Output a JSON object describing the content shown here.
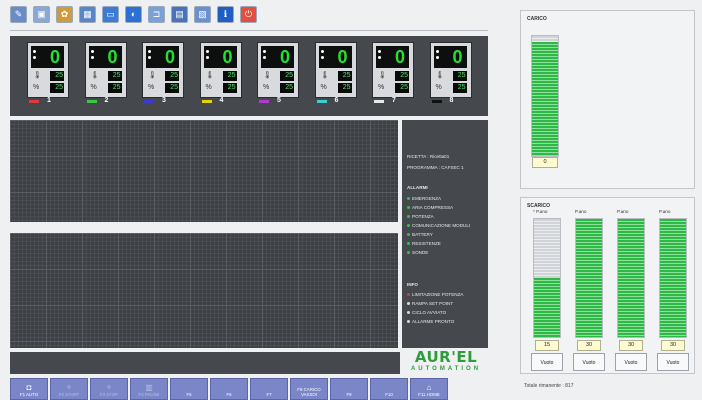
{
  "toolbar": {
    "icons": [
      {
        "name": "edit-icon",
        "color": "#6a8bc8"
      },
      {
        "name": "image-icon",
        "color": "#8aa7d6"
      },
      {
        "name": "paint-icon",
        "color": "#d29a3a"
      },
      {
        "name": "grid-icon",
        "color": "#5a86c8"
      },
      {
        "name": "monitor-icon",
        "color": "#3c7bd6"
      },
      {
        "name": "chart-icon",
        "color": "#2d6fd2"
      },
      {
        "name": "tag-icon",
        "color": "#7aa0d8"
      },
      {
        "name": "calculator-icon",
        "color": "#4a72b8"
      },
      {
        "name": "folder-icon",
        "color": "#6b8fd0"
      },
      {
        "name": "info-icon",
        "color": "#1f5fc4"
      },
      {
        "name": "power-icon",
        "color": "#e05040"
      }
    ]
  },
  "tiles": [
    {
      "number": "1",
      "value": "0",
      "sp": "25",
      "act": "25",
      "color": "#e03a3a"
    },
    {
      "number": "2",
      "value": "0",
      "sp": "25",
      "act": "25",
      "color": "#3ec63e"
    },
    {
      "number": "3",
      "value": "0",
      "sp": "25",
      "act": "25",
      "color": "#3a3ad0"
    },
    {
      "number": "4",
      "value": "0",
      "sp": "25",
      "act": "25",
      "color": "#e6d200"
    },
    {
      "number": "5",
      "value": "0",
      "sp": "25",
      "act": "25",
      "color": "#b23ad0"
    },
    {
      "number": "6",
      "value": "0",
      "sp": "25",
      "act": "25",
      "color": "#3ad0d0"
    },
    {
      "number": "7",
      "value": "0",
      "sp": "25",
      "act": "25",
      "color": "#e8e8e8"
    },
    {
      "number": "8",
      "value": "0",
      "sp": "25",
      "act": "25",
      "color": "#111111"
    }
  ],
  "info": {
    "line1": "RICETTA : Ricetta01",
    "line2": "PROGRAMMA : CAFSEC 1",
    "alarms_title": "ALLARMI",
    "alarms": [
      {
        "label": "EMERGENZA",
        "color": "#34c24a"
      },
      {
        "label": "ARIA COMPRESSA",
        "color": "#34c24a"
      },
      {
        "label": "POTENZA",
        "color": "#34c24a"
      },
      {
        "label": "COMUNICAZIONE MODULI",
        "color": "#34c24a"
      },
      {
        "label": "BATTERY",
        "color": "#34c24a"
      },
      {
        "label": "RESISTENZE",
        "color": "#34c24a"
      },
      {
        "label": "SONDE",
        "color": "#34c24a"
      }
    ],
    "info_title": "INFO",
    "info_items": [
      {
        "label": "LIMITAZIONE POTENZA",
        "color": "#e03a3a"
      },
      {
        "label": "RAMPA SET POINT",
        "color": "#d8d8d8"
      },
      {
        "label": "CICLO AVVIATO",
        "color": "#d8d8d8"
      },
      {
        "label": "ALLARME PRONTO",
        "color": "#d8d8d8"
      }
    ]
  },
  "logo": {
    "top": "AUR'EL",
    "bottom": "AUTOMATION"
  },
  "fkeys": [
    {
      "label": "F1 AUTO",
      "icon": "◘",
      "dim": false
    },
    {
      "label": "F2 START",
      "icon": "✧",
      "dim": true
    },
    {
      "label": "F3 STOP",
      "icon": "✧",
      "dim": true
    },
    {
      "label": "F4 PAUSE",
      "icon": "▥",
      "dim": true
    },
    {
      "label": "F5",
      "icon": "",
      "dim": false
    },
    {
      "label": "F6",
      "icon": "",
      "dim": false
    },
    {
      "label": "F7",
      "icon": "",
      "dim": false
    },
    {
      "label": "F8 CARICO VASSOI",
      "icon": "",
      "dim": false
    },
    {
      "label": "F9",
      "icon": "",
      "dim": false
    },
    {
      "label": "F10",
      "icon": "",
      "dim": false
    },
    {
      "label": "F11 HOME",
      "icon": "⌂",
      "dim": false
    }
  ],
  "carico": {
    "title": "CARICO",
    "value": "0",
    "level": 0.95
  },
  "scarico": {
    "title": "SCARICO",
    "columns": [
      {
        "header": "* P.ano",
        "value": "15",
        "level": 0.5,
        "button": "Vuoto"
      },
      {
        "header": "P.ano",
        "value": "30",
        "level": 1.0,
        "button": "Vuoto"
      },
      {
        "header": "P.ano",
        "value": "30",
        "level": 1.0,
        "button": "Vuoto"
      },
      {
        "header": "P.ano",
        "value": "30",
        "level": 1.0,
        "button": "Vuoto"
      }
    ]
  },
  "status": "Totale rimanente : 817"
}
